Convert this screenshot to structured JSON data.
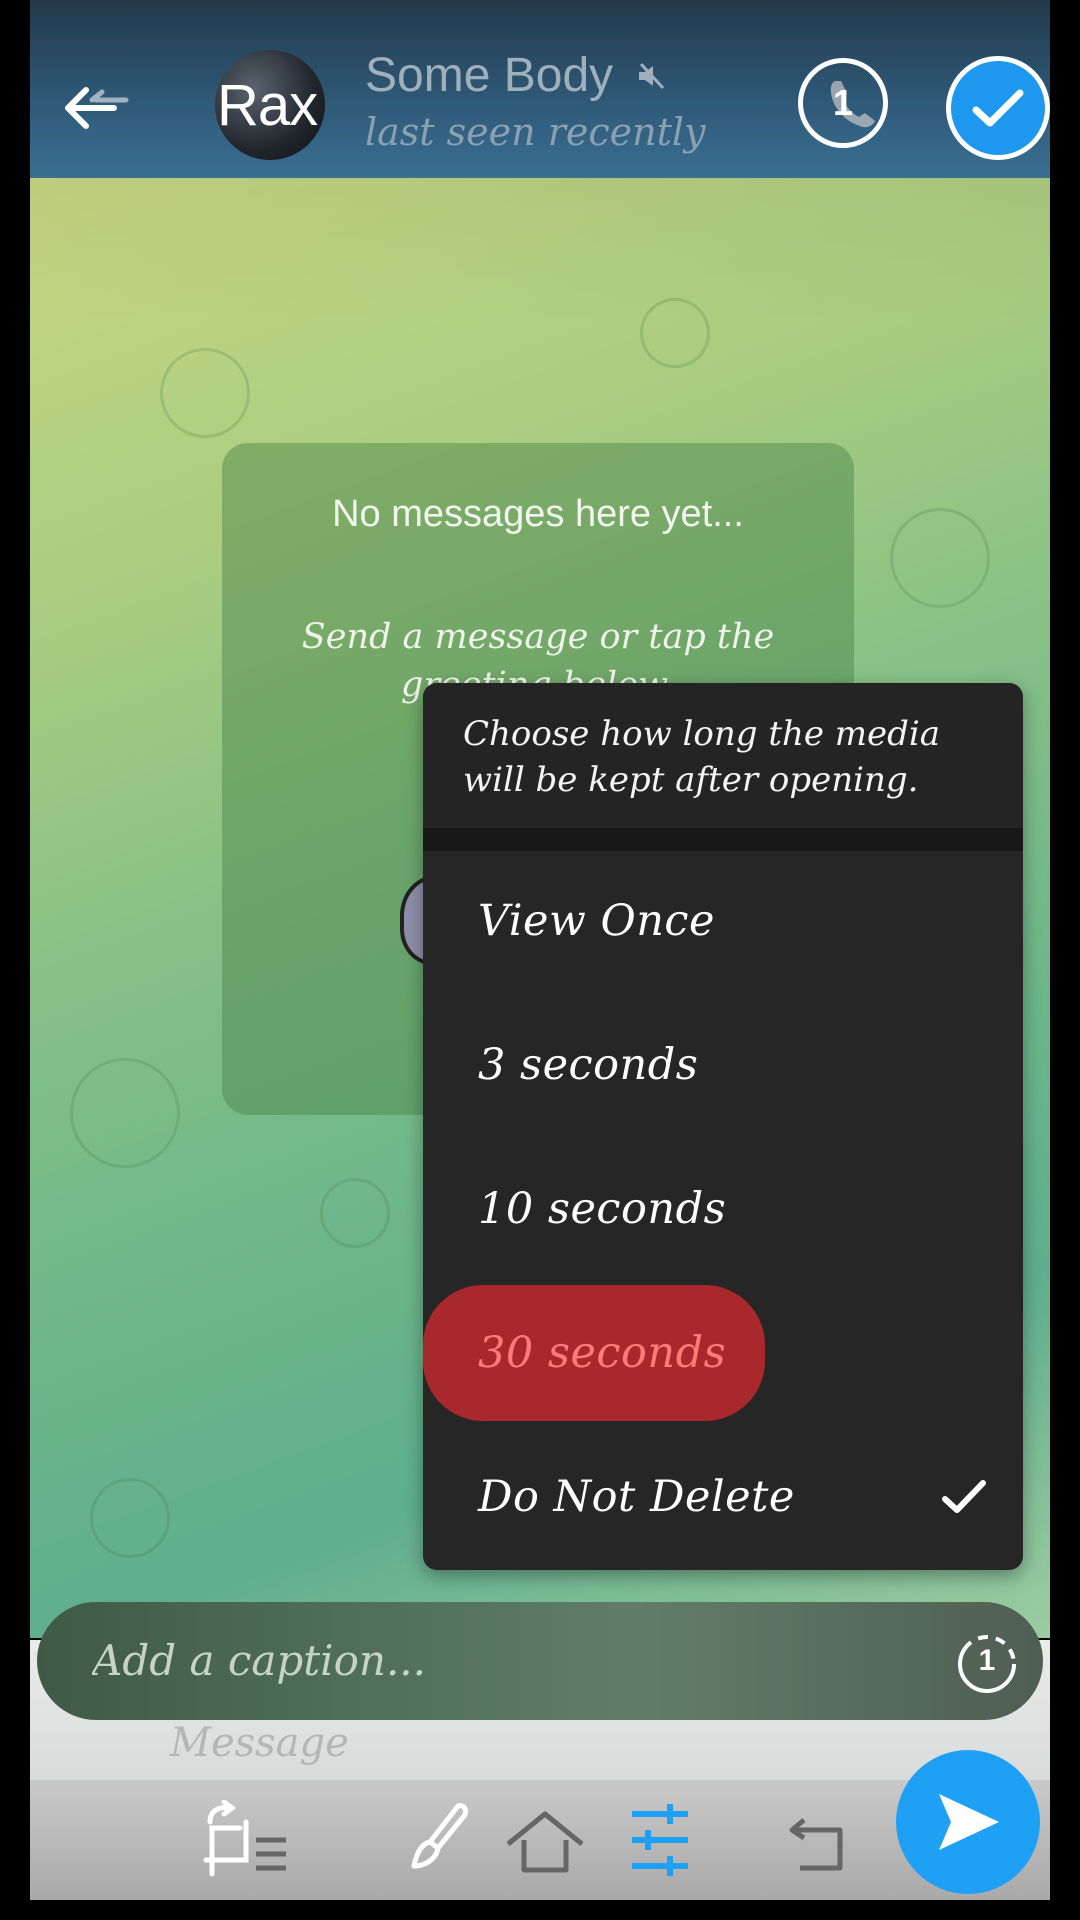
{
  "header": {
    "back_icon": "arrow-left-icon",
    "avatar_initials": "Rax",
    "contact_name": "Some Body",
    "muted_icon": "speaker-muted-icon",
    "status": "last seen recently",
    "timer_count": "1",
    "confirm_icon": "checkmark-icon"
  },
  "chat": {
    "empty_title": "No messages here yet...",
    "empty_subtitle": "Send a message or tap the greeting below."
  },
  "timer_menu": {
    "description": "Choose how long the media will be kept after opening.",
    "options": [
      {
        "label": "View Once",
        "highlighted": false,
        "checked": false
      },
      {
        "label": "3 seconds",
        "highlighted": false,
        "checked": false
      },
      {
        "label": "10 seconds",
        "highlighted": false,
        "checked": false
      },
      {
        "label": "30 seconds",
        "highlighted": true,
        "checked": false
      },
      {
        "label": "Do Not Delete",
        "highlighted": false,
        "checked": true
      }
    ],
    "highlight_color": "#a8282b",
    "highlight_text_color": "#ff7a7a"
  },
  "caption": {
    "placeholder": "Add a caption...",
    "timer_count": "1"
  },
  "underlay": {
    "message_placeholder": "Message"
  },
  "toolbar": {
    "tools": [
      "crop-rotate-icon",
      "brush-icon",
      "adjust-sliders-icon"
    ],
    "active_tool": "adjust-sliders-icon",
    "accent": "#1ea1f5",
    "send_icon": "send-icon"
  }
}
